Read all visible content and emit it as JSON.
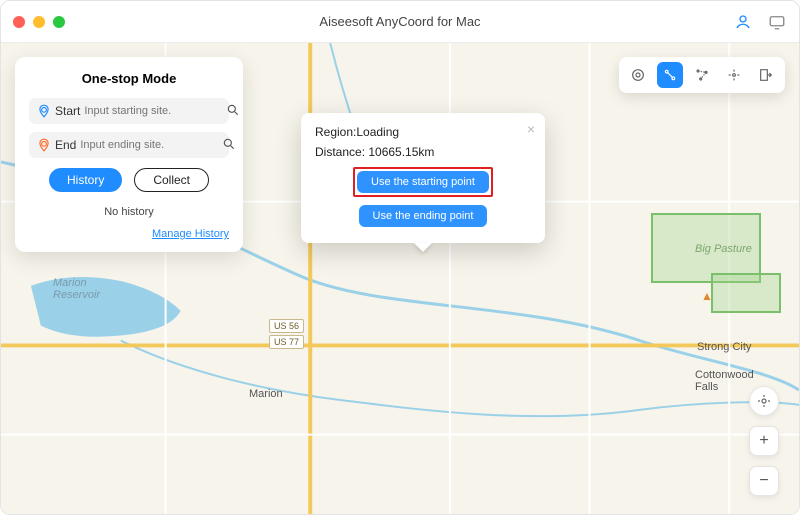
{
  "app": {
    "title": "Aiseesoft AnyCoord for Mac"
  },
  "sidepanel": {
    "title": "One-stop Mode",
    "start_label": "Start",
    "start_placeholder": "Input starting site.",
    "end_label": "End",
    "end_placeholder": "Input ending site.",
    "history_btn": "History",
    "collect_btn": "Collect",
    "no_history": "No history",
    "manage": "Manage History"
  },
  "popup": {
    "region_label": "Region:Loading",
    "distance_label": "Distance: 10665.15km",
    "use_start": "Use the starting point",
    "use_end": "Use the ending point"
  },
  "map_labels": {
    "us56": "US 56",
    "us77": "US 77",
    "marion": "Marion",
    "marion_res": "Marion\nReservoir",
    "big_pasture": "Big Pasture",
    "strong_city": "Strong City",
    "cottonwood": "Cottonwood\nFalls"
  },
  "zoom": {
    "plus": "+",
    "minus": "−"
  }
}
